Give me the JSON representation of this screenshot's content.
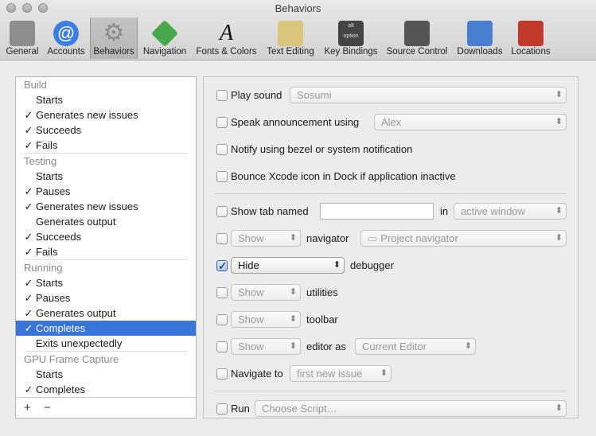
{
  "window": {
    "title": "Behaviors"
  },
  "toolbar": {
    "items": [
      {
        "label": "General",
        "icon": "general-switch-icon",
        "color": "#8d8d8d"
      },
      {
        "label": "Accounts",
        "icon": "at-sign-icon",
        "color": "#3b7ee6"
      },
      {
        "label": "Behaviors",
        "icon": "gear-icon",
        "color": "#8a8a8a"
      },
      {
        "label": "Navigation",
        "icon": "navigation-arrows-icon",
        "color": "#46a84a"
      },
      {
        "label": "Fonts & Colors",
        "icon": "font-letter-icon",
        "color": "#c23fa6"
      },
      {
        "label": "Text Editing",
        "icon": "notepad-pencil-icon",
        "color": "#d9c67a"
      },
      {
        "label": "Key Bindings",
        "icon": "keyboard-key-icon",
        "color": "#444444",
        "glyph_top": "alt",
        "glyph_bottom": "option"
      },
      {
        "label": "Source Control",
        "icon": "source-control-icon",
        "color": "#555555"
      },
      {
        "label": "Downloads",
        "icon": "download-box-icon",
        "color": "#4a7fd0"
      },
      {
        "label": "Locations",
        "icon": "joystick-location-icon",
        "color": "#c0392b"
      }
    ]
  },
  "sidebar": {
    "groups": [
      {
        "title": "Build",
        "items": [
          {
            "label": "Starts",
            "checked": false
          },
          {
            "label": "Generates new issues",
            "checked": true
          },
          {
            "label": "Succeeds",
            "checked": true
          },
          {
            "label": "Fails",
            "checked": true
          }
        ]
      },
      {
        "title": "Testing",
        "items": [
          {
            "label": "Starts",
            "checked": false
          },
          {
            "label": "Pauses",
            "checked": true
          },
          {
            "label": "Generates new issues",
            "checked": true
          },
          {
            "label": "Generates output",
            "checked": false
          },
          {
            "label": "Succeeds",
            "checked": true
          },
          {
            "label": "Fails",
            "checked": true
          }
        ]
      },
      {
        "title": "Running",
        "items": [
          {
            "label": "Starts",
            "checked": true
          },
          {
            "label": "Pauses",
            "checked": true
          },
          {
            "label": "Generates output",
            "checked": true
          },
          {
            "label": "Completes",
            "checked": true,
            "selected": true
          },
          {
            "label": "Exits unexpectedly",
            "checked": false
          }
        ]
      },
      {
        "title": "GPU Frame Capture",
        "items": [
          {
            "label": "Starts",
            "checked": false
          },
          {
            "label": "Completes",
            "checked": true
          }
        ]
      }
    ],
    "check_glyph": "✓",
    "add_label": "+",
    "remove_label": "−",
    "selection_color": "#3875d7"
  },
  "options": {
    "play_sound": {
      "label": "Play sound",
      "checked": false,
      "value": "Sosumi"
    },
    "speak": {
      "label": "Speak announcement using",
      "checked": false,
      "value": "Alex"
    },
    "notify": {
      "label": "Notify using bezel or system notification",
      "checked": false
    },
    "bounce": {
      "label": "Bounce Xcode icon in Dock if application inactive",
      "checked": false
    },
    "show_tab": {
      "label": "Show tab named",
      "checked": false,
      "in_label": "in",
      "value": "active window",
      "tab_name": ""
    },
    "navigator": {
      "action": "Show",
      "label": "navigator",
      "checked": false,
      "value": "Project navigator"
    },
    "debugger": {
      "action": "Hide",
      "label": "debugger",
      "checked": true
    },
    "utilities": {
      "action": "Show",
      "label": "utilities",
      "checked": false
    },
    "toolbar": {
      "action": "Show",
      "label": "toolbar",
      "checked": false
    },
    "editor": {
      "action": "Show",
      "label": "editor as",
      "checked": false,
      "value": "Current Editor"
    },
    "navigate": {
      "label": "Navigate to",
      "checked": false,
      "value": "first new issue"
    },
    "run": {
      "label": "Run",
      "checked": false,
      "value": "Choose Script…"
    }
  }
}
